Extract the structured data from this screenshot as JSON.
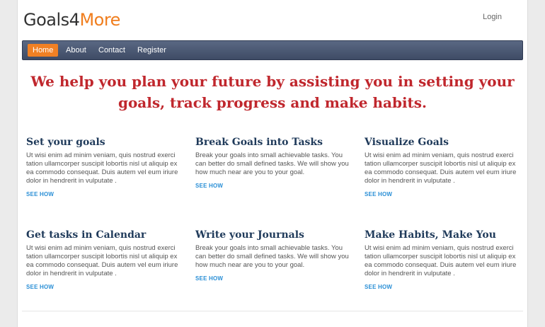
{
  "header": {
    "logo_part1": "Goals4",
    "logo_part2": "More",
    "login_label": "Login"
  },
  "nav": {
    "items": [
      {
        "label": "Home"
      },
      {
        "label": "About"
      },
      {
        "label": "Contact"
      },
      {
        "label": "Register"
      }
    ]
  },
  "hero": {
    "line1": "We help you plan your future by assisting you in setting your",
    "line2": "goals, track progress and make habits."
  },
  "features": [
    {
      "title": "Set your goals",
      "text": "Ut wisi enim ad minim veniam, quis nostrud exerci tation ullamcorper suscipit lobortis nisl ut aliquip ex ea commodo consequat. Duis autem vel eum iriure dolor in hendrerit in vulputate .",
      "link": "SEE HOW"
    },
    {
      "title": "Break Goals into Tasks",
      "text": "Break your goals into small achievable tasks. You can better do small defined tasks. We will show you how much near are you to your goal.",
      "link": "SEE HOW"
    },
    {
      "title": "Visualize Goals",
      "text": "Ut wisi enim ad minim veniam, quis nostrud exerci tation ullamcorper suscipit lobortis nisl ut aliquip ex ea commodo consequat. Duis autem vel eum iriure dolor in hendrerit in vulputate .",
      "link": "SEE HOW"
    },
    {
      "title": "Get tasks in Calendar",
      "text": "Ut wisi enim ad minim veniam, quis nostrud exerci tation ullamcorper suscipit lobortis nisl ut aliquip ex ea commodo consequat. Duis autem vel eum iriure dolor in hendrerit in vulputate .",
      "link": "SEE HOW"
    },
    {
      "title": "Write your Journals",
      "text": "Break your goals into small achievable tasks. You can better do small defined tasks. We will show you how much near are you to your goal.",
      "link": "SEE HOW"
    },
    {
      "title": "Make Habits, Make You",
      "text": "Ut wisi enim ad minim veniam, quis nostrud exerci tation ullamcorper suscipit lobortis nisl ut aliquip ex ea commodo consequat. Duis autem vel eum iriure dolor in hendrerit in vulputate .",
      "link": "SEE HOW"
    }
  ],
  "colors": {
    "accent": "#f08024",
    "hero_text": "#c0272d",
    "heading": "#1f3a5a",
    "link": "#2a8fd6",
    "nav_bg": "#4a5774"
  }
}
